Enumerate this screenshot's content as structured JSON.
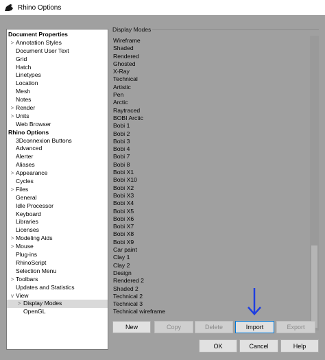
{
  "window": {
    "title": "Rhino Options"
  },
  "tree": [
    {
      "label": "Document Properties",
      "level": 0,
      "expander": ""
    },
    {
      "label": "Annotation Styles",
      "level": 1,
      "expander": ">"
    },
    {
      "label": "Document User Text",
      "level": 1,
      "expander": ""
    },
    {
      "label": "Grid",
      "level": 1,
      "expander": ""
    },
    {
      "label": "Hatch",
      "level": 1,
      "expander": ""
    },
    {
      "label": "Linetypes",
      "level": 1,
      "expander": ""
    },
    {
      "label": "Location",
      "level": 1,
      "expander": ""
    },
    {
      "label": "Mesh",
      "level": 1,
      "expander": ""
    },
    {
      "label": "Notes",
      "level": 1,
      "expander": ""
    },
    {
      "label": "Render",
      "level": 1,
      "expander": ">"
    },
    {
      "label": "Units",
      "level": 1,
      "expander": ">"
    },
    {
      "label": "Web Browser",
      "level": 1,
      "expander": ""
    },
    {
      "label": "Rhino Options",
      "level": 0,
      "expander": ""
    },
    {
      "label": "3Dconnexion Buttons",
      "level": 1,
      "expander": ""
    },
    {
      "label": "Advanced",
      "level": 1,
      "expander": ""
    },
    {
      "label": "Alerter",
      "level": 1,
      "expander": ""
    },
    {
      "label": "Aliases",
      "level": 1,
      "expander": ""
    },
    {
      "label": "Appearance",
      "level": 1,
      "expander": ">"
    },
    {
      "label": "Cycles",
      "level": 1,
      "expander": ""
    },
    {
      "label": "Files",
      "level": 1,
      "expander": ">"
    },
    {
      "label": "General",
      "level": 1,
      "expander": ""
    },
    {
      "label": "Idle Processor",
      "level": 1,
      "expander": ""
    },
    {
      "label": "Keyboard",
      "level": 1,
      "expander": ""
    },
    {
      "label": "Libraries",
      "level": 1,
      "expander": ""
    },
    {
      "label": "Licenses",
      "level": 1,
      "expander": ""
    },
    {
      "label": "Modeling Aids",
      "level": 1,
      "expander": ">"
    },
    {
      "label": "Mouse",
      "level": 1,
      "expander": ">"
    },
    {
      "label": "Plug-ins",
      "level": 1,
      "expander": ""
    },
    {
      "label": "RhinoScript",
      "level": 1,
      "expander": ""
    },
    {
      "label": "Selection Menu",
      "level": 1,
      "expander": ""
    },
    {
      "label": "Toolbars",
      "level": 1,
      "expander": ">"
    },
    {
      "label": "Updates and Statistics",
      "level": 1,
      "expander": ""
    },
    {
      "label": "View",
      "level": 1,
      "expander": "v"
    },
    {
      "label": "Display Modes",
      "level": 2,
      "expander": ">",
      "selected": true
    },
    {
      "label": "OpenGL",
      "level": 2,
      "expander": ""
    }
  ],
  "display_modes": {
    "group_label": "Display Modes",
    "items": [
      "Wireframe",
      "Shaded",
      "Rendered",
      "Ghosted",
      "X-Ray",
      "Technical",
      "Artistic",
      "Pen",
      "Arctic",
      "Raytraced",
      "BOBI Arctic",
      "Bobi 1",
      "Bobi 2",
      "Bobi 3",
      "Bobi 4",
      "Bobi 7",
      "Bobi 8",
      "Bobi X1",
      "Bobi X10",
      "Bobi X2",
      "Bobi X3",
      "Bobi X4",
      "Bobi X5",
      "Bobi X6",
      "Bobi X7",
      "Bobi X8",
      "Bobi X9",
      "Car paint",
      "Clay 1",
      "Clay 2",
      "Design",
      "Rendered 2",
      "Shaded 2",
      "Technical 2",
      "Technical 3",
      "Technical wireframe"
    ]
  },
  "buttons": {
    "new": "New",
    "copy": "Copy",
    "delete": "Delete",
    "import": "Import",
    "export": "Export",
    "ok": "OK",
    "cancel": "Cancel",
    "help": "Help"
  },
  "colors": {
    "annotation_arrow": "#1f3fe0"
  }
}
